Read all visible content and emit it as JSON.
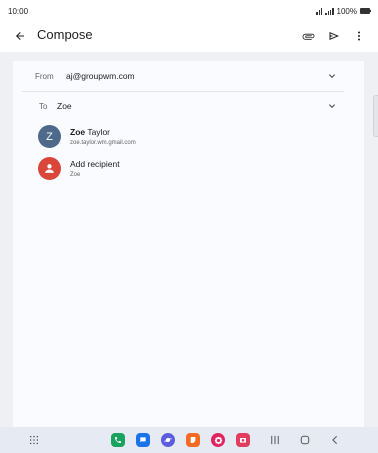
{
  "status_bar": {
    "time": "10:00",
    "battery": "100%"
  },
  "app_bar": {
    "title": "Compose",
    "icons": [
      "back-arrow-icon",
      "attachment-icon",
      "send-icon",
      "more-vert-icon"
    ]
  },
  "compose": {
    "from_label": "From",
    "from_value": "aj@groupwm.com",
    "to_label": "To",
    "to_value": "Zoe"
  },
  "suggestions": [
    {
      "initial": "Z",
      "name_bold": "Zoe",
      "name_rest": " Taylor",
      "sub": "zoe.taylor.wm.gmail.com",
      "avatar_color": "#4d6a8a"
    },
    {
      "initial": "",
      "name_bold": "",
      "name_rest": "Add recipient",
      "sub": "Zoe",
      "avatar_color": "#d9463a"
    }
  ],
  "nav_bar": {
    "apps": [
      {
        "name": "phone-app-icon",
        "color": "#1aa260"
      },
      {
        "name": "messages-app-icon",
        "color": "#1a73e8"
      },
      {
        "name": "internet-app-icon",
        "color": "#5c5ce0"
      },
      {
        "name": "notes-app-icon",
        "color": "#f26b21"
      },
      {
        "name": "galaxy-store-app-icon",
        "color": "#e0245e"
      },
      {
        "name": "camera-app-icon",
        "color": "#e23d5e"
      }
    ]
  }
}
